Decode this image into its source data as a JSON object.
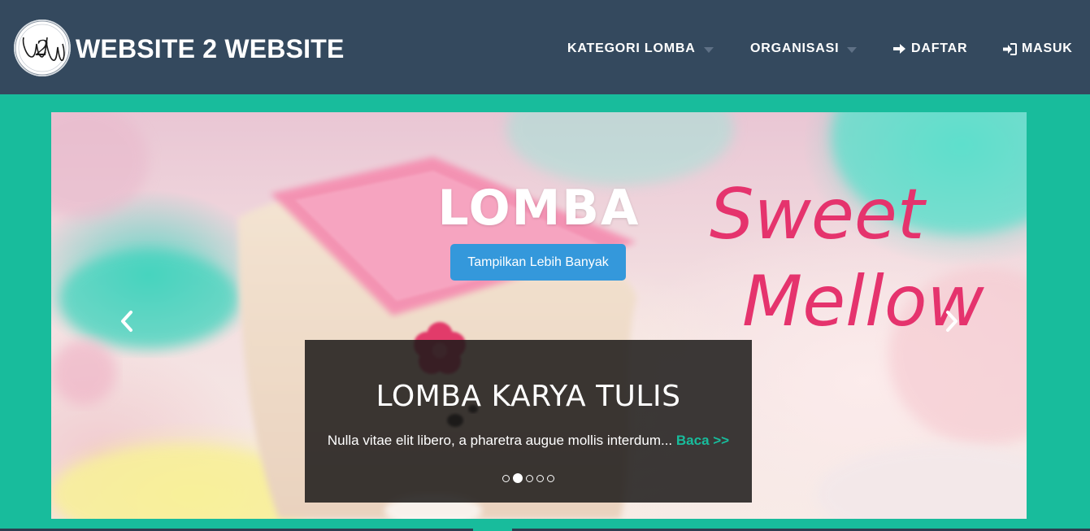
{
  "brand": {
    "logo_text": "W2W",
    "title": "WEBSITE 2 WEBSITE"
  },
  "nav": {
    "items": [
      {
        "label": "KATEGORI LOMBA",
        "icon": "caret-down-icon"
      },
      {
        "label": "ORGANISASI",
        "icon": "caret-down-icon"
      },
      {
        "label": "DAFTAR",
        "icon": "arrow-right-icon"
      },
      {
        "label": "MASUK",
        "icon": "sign-in-icon"
      }
    ]
  },
  "carousel": {
    "slide": {
      "title": "LOMBA",
      "button_label": "Tampilkan Lebih Banyak",
      "image_text": [
        "Sweet",
        "Mellow"
      ]
    },
    "caption": {
      "title": "LOMBA KARYA TULIS",
      "text": "Nulla vitae elit libero, a pharetra augue mollis interdum...",
      "link": "Baca >>"
    },
    "indicators": {
      "count": 5,
      "active_index": 1
    },
    "prev_icon": "chevron-left-icon",
    "next_icon": "chevron-right-icon"
  },
  "colors": {
    "navbar": "#34495e",
    "page_background": "#18bc9c",
    "button": "#3498db",
    "caption_link": "#18bc9c"
  }
}
